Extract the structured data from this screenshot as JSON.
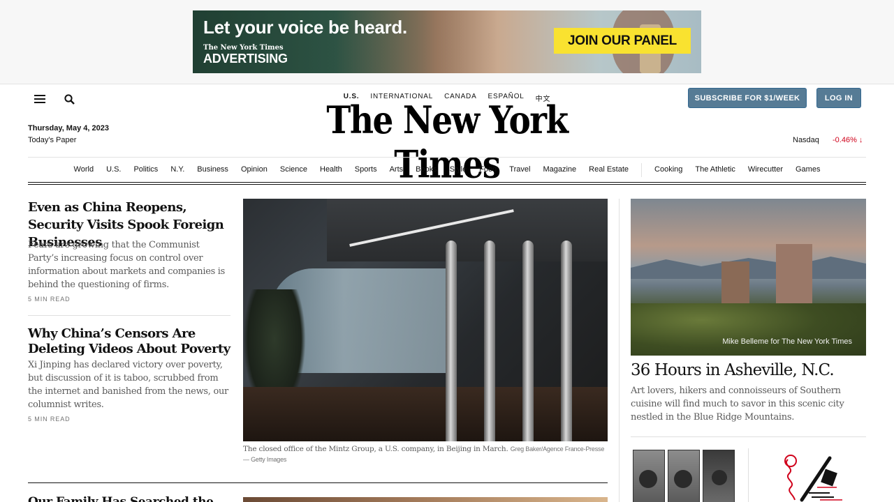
{
  "ad": {
    "headline": "Let your voice be heard.",
    "brand_line1": "The New York Times",
    "brand_line2": "ADVERTISING",
    "cta": "JOIN OUR PANEL"
  },
  "masthead": {
    "editions": [
      "U.S.",
      "INTERNATIONAL",
      "CANADA",
      "ESPAÑOL",
      "中文"
    ],
    "subscribe_label": "SUBSCRIBE FOR $1/WEEK",
    "login_label": "LOG IN",
    "date": "Thursday, May 4, 2023",
    "todays_paper": "Today's Paper",
    "logo": "The New York Times",
    "ticker_name": "Nasdaq",
    "ticker_value": "-0.46%",
    "ticker_arrow": "↓"
  },
  "nav": {
    "sections": [
      "World",
      "U.S.",
      "Politics",
      "N.Y.",
      "Business",
      "Opinion",
      "Science",
      "Health",
      "Sports",
      "Arts",
      "Books",
      "Style",
      "Food",
      "Travel",
      "Magazine",
      "Real Estate"
    ],
    "products": [
      "Cooking",
      "The Athletic",
      "Wirecutter",
      "Games"
    ]
  },
  "stories": [
    {
      "headline": "Even as China Reopens, Security Visits Spook Foreign Businesses",
      "summary": "Fears are growing that the Communist Party’s increasing focus on control over information about markets and companies is behind the questioning of firms.",
      "read_time": "5 MIN READ"
    },
    {
      "headline": "Why China’s Censors Are Deleting Videos About Poverty",
      "summary": "Xi Jinping has declared victory over poverty, but discussion of it is taboo, scrubbed from the internet and banished from the news, our columnist writes.",
      "read_time": "5 MIN READ"
    }
  ],
  "main_photo": {
    "caption": "The closed office of the Mintz Group, a U.S. company, in Beijing in March.",
    "credit": "Greg Baker/Agence France-Presse — Getty Images"
  },
  "next_story_peek": "Our Family Has Searched the",
  "side_story": {
    "photo_credit": "Mike Belleme for The New York Times",
    "headline": "36 Hours in Asheville, N.C.",
    "summary": "Art lovers, hikers and connoisseurs of Southern cuisine will find much to savor in this scenic city nestled in the Blue Ridge Mountains."
  },
  "colors": {
    "subscribe_bg": "#567b95",
    "ticker_negative": "#d0021b",
    "ad_cta_bg": "#f9e230"
  }
}
